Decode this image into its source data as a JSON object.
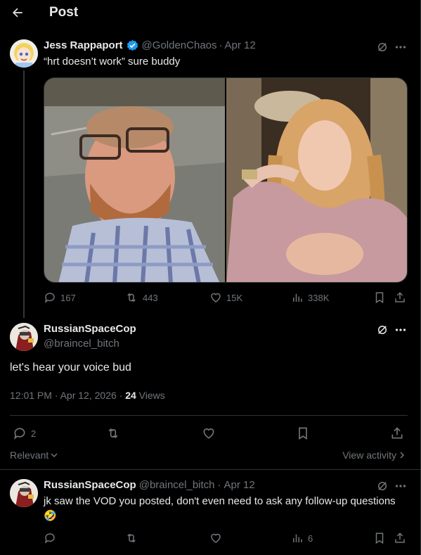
{
  "header": {
    "title": "Post"
  },
  "tweet1": {
    "author_name": "Jess Rappaport",
    "handle": "@GoldenChaos",
    "separator": "·",
    "date": "Apr 12",
    "text": "“hrt doesn’t work” sure buddy",
    "stats": {
      "replies": "167",
      "reposts": "443",
      "likes": "15K",
      "views": "338K"
    }
  },
  "main_tweet": {
    "author_name": "RussianSpaceCop",
    "handle": "@braincel_bitch",
    "text": "let's hear your voice bud",
    "timestamp": "12:01 PM · Apr 12, 2026 · ",
    "views_count": "24",
    "views_label": " Views",
    "stats": {
      "replies": "2"
    }
  },
  "sort": {
    "label": "Relevant",
    "activity_label": "View activity"
  },
  "reply": {
    "author_name": "RussianSpaceCop",
    "handle": "@braincel_bitch",
    "separator": "·",
    "date": "Apr 12",
    "text": "jk saw the VOD you posted, don't even need to ask any follow-up questions",
    "emoji": "🤣",
    "stats": {
      "views": "6"
    }
  },
  "colors": {
    "accent": "#1d9bf0",
    "muted": "#71767b",
    "border": "#2f3336"
  }
}
